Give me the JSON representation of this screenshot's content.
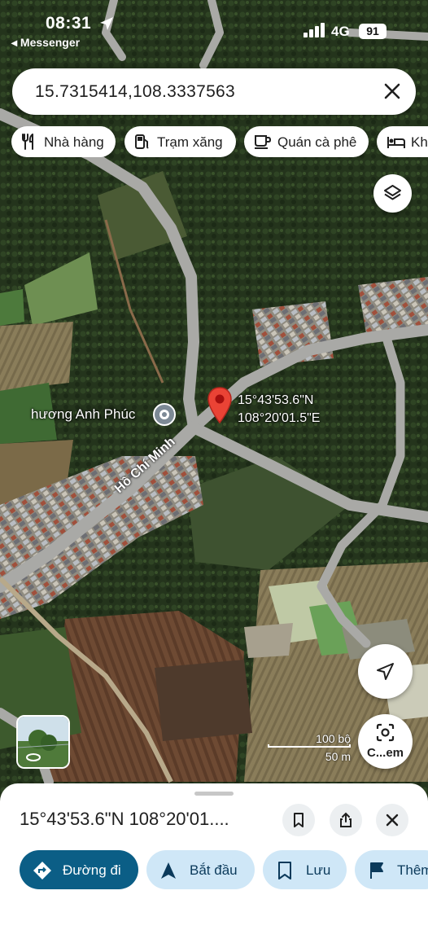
{
  "status_bar": {
    "time": "08:31",
    "back_app": "◂ Messenger",
    "network": "4G",
    "battery": "91"
  },
  "search": {
    "query": "15.7315414,108.3337563"
  },
  "chips": [
    {
      "label": "Nhà hàng",
      "icon": "restaurant-icon"
    },
    {
      "label": "Trạm xăng",
      "icon": "gas-station-icon"
    },
    {
      "label": "Quán cà phê",
      "icon": "coffee-icon"
    },
    {
      "label": "Kha",
      "icon": "hotel-icon"
    }
  ],
  "map": {
    "pin_coords_lat": "15°43'53.6\"N",
    "pin_coords_lng": "108°20'01.5\"E",
    "place_label": "hương Anh Phúc",
    "road_label": "Hồ Chí Minh",
    "scale_top": "100 bộ",
    "scale_bottom": "50 m",
    "lens_label": "C...em"
  },
  "sheet": {
    "title": "15°43'53.6\"N 108°20'01....",
    "actions": [
      {
        "label": "Đường đi",
        "icon": "directions-icon"
      },
      {
        "label": "Bắt đầu",
        "icon": "navigation-icon"
      },
      {
        "label": "Lưu",
        "icon": "bookmark-icon"
      },
      {
        "label": "Thêm",
        "icon": "flag-icon"
      }
    ]
  },
  "colors": {
    "primary_button": "#0b5e86",
    "secondary_button": "#cfe7f7",
    "pin": "#ea4335"
  }
}
